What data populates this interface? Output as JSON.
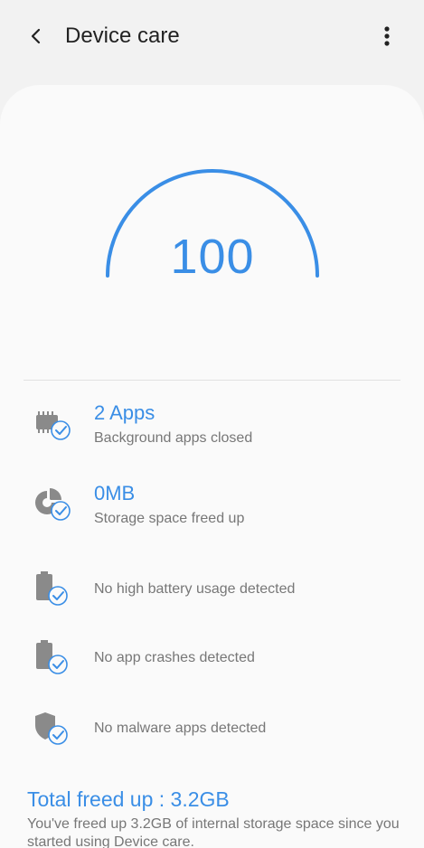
{
  "appbar": {
    "title": "Device care",
    "back_icon": "chevron-left-icon",
    "more_icon": "more-vertical-icon"
  },
  "score": {
    "value": "100",
    "max": 100,
    "accent": "#3a8ee6"
  },
  "results": [
    {
      "icon": "memory-chip-check-icon",
      "title": "2 Apps",
      "subtitle": "Background apps closed"
    },
    {
      "icon": "storage-pie-check-icon",
      "title": "0MB",
      "subtitle": "Storage space freed up"
    },
    {
      "icon": "battery-check-icon",
      "title": "",
      "subtitle": "No high battery usage detected"
    },
    {
      "icon": "app-crash-check-icon",
      "title": "",
      "subtitle": "No app crashes detected"
    },
    {
      "icon": "shield-check-icon",
      "title": "",
      "subtitle": "No malware apps detected"
    }
  ],
  "total": {
    "title": "Total freed up : 3.2GB",
    "description": "You've freed up 3.2GB of internal storage space since you started using Device care."
  },
  "colors": {
    "accent": "#3a8ee6",
    "icon_gray": "#8a8a8a",
    "background": "#f2f2f2",
    "card": "#fafafa"
  }
}
